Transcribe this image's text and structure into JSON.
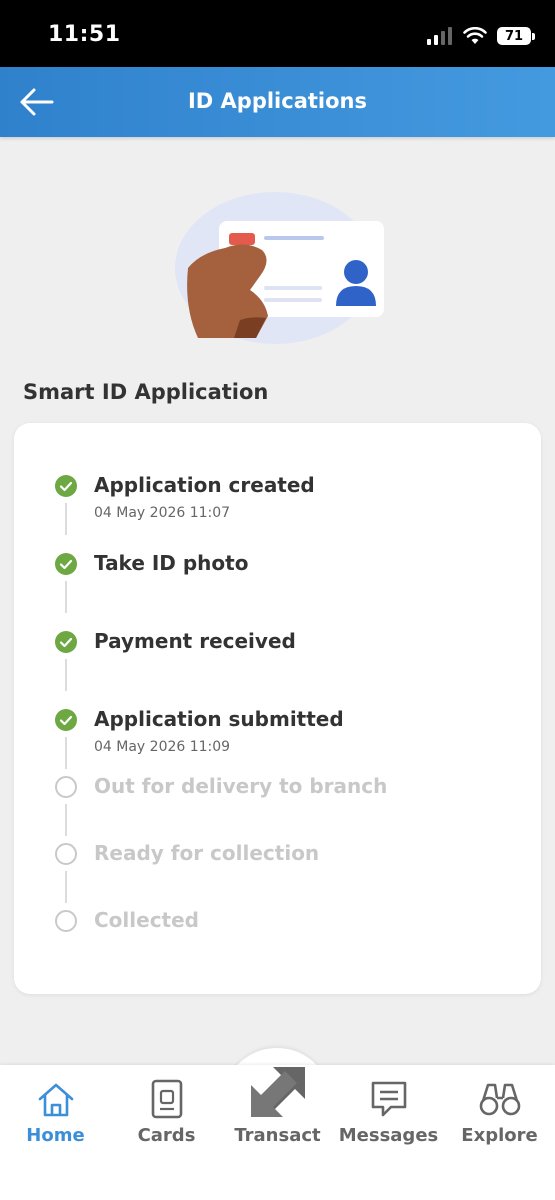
{
  "status_bar": {
    "time": "11:51",
    "battery": "71"
  },
  "header": {
    "title": "ID Applications"
  },
  "section": {
    "title": "Smart ID Application"
  },
  "steps": [
    {
      "label": "Application created",
      "date": "04 May 2026 11:07",
      "state": "done"
    },
    {
      "label": "Take ID photo",
      "date": "",
      "state": "done"
    },
    {
      "label": "Payment received",
      "date": "",
      "state": "done"
    },
    {
      "label": "Application submitted",
      "date": "04 May 2026 11:09",
      "state": "done"
    },
    {
      "label": "Out for delivery to branch",
      "date": "",
      "state": "pending"
    },
    {
      "label": "Ready for collection",
      "date": "",
      "state": "pending"
    },
    {
      "label": "Collected",
      "date": "",
      "state": "pending"
    }
  ],
  "nav": {
    "items": [
      {
        "label": "Home",
        "icon": "home-icon",
        "active": true
      },
      {
        "label": "Cards",
        "icon": "card-icon",
        "active": false
      },
      {
        "label": "Transact",
        "icon": "transact-icon",
        "active": false
      },
      {
        "label": "Messages",
        "icon": "message-icon",
        "active": false
      },
      {
        "label": "Explore",
        "icon": "binoculars-icon",
        "active": false
      }
    ]
  },
  "colors": {
    "header_start": "#2f81cc",
    "header_end": "#449adf",
    "step_done": "#6ea842",
    "step_pending": "#c9c9c9",
    "nav_active": "#3a8fd8"
  }
}
